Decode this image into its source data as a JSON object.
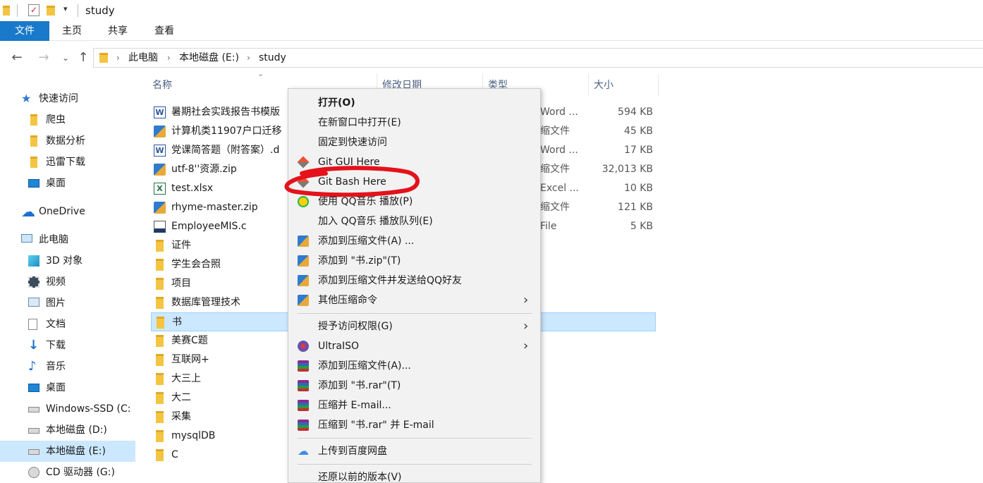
{
  "window": {
    "title": "study"
  },
  "ribbon": {
    "tabs": [
      "文件",
      "主页",
      "共享",
      "查看"
    ]
  },
  "address": {
    "crumbs": [
      "此电脑",
      "本地磁盘 (E:)",
      "study"
    ]
  },
  "sidebar": {
    "items": [
      {
        "label": "快速访问",
        "icon": "star-icon"
      },
      {
        "label": "爬虫",
        "icon": "folder-icon"
      },
      {
        "label": "数据分析",
        "icon": "folder-icon"
      },
      {
        "label": "迅雷下载",
        "icon": "folder-icon"
      },
      {
        "label": "桌面",
        "icon": "desktop-icon"
      },
      {
        "label": "OneDrive",
        "icon": "cloud-icon"
      },
      {
        "label": "此电脑",
        "icon": "computer-icon"
      },
      {
        "label": "3D 对象",
        "icon": "cube-icon"
      },
      {
        "label": "视频",
        "icon": "film-icon"
      },
      {
        "label": "图片",
        "icon": "picture-icon"
      },
      {
        "label": "文档",
        "icon": "document-icon"
      },
      {
        "label": "下载",
        "icon": "download-icon"
      },
      {
        "label": "音乐",
        "icon": "music-icon"
      },
      {
        "label": "桌面",
        "icon": "desktop-icon"
      },
      {
        "label": "Windows-SSD (C:",
        "icon": "drive-icon"
      },
      {
        "label": "本地磁盘 (D:)",
        "icon": "drive-icon"
      },
      {
        "label": "本地磁盘 (E:)",
        "icon": "drive-icon"
      },
      {
        "label": "CD 驱动器 (G:)",
        "icon": "cd-icon"
      }
    ]
  },
  "columns": {
    "name": "名称",
    "date": "修改日期",
    "type": "类型",
    "size": "大小"
  },
  "files": [
    {
      "name": "暑期社会实践报告书模版",
      "type": "Word ...",
      "size": "594 KB",
      "icon": "word-icon"
    },
    {
      "name": "计算机类11907户口迁移",
      "type": "缩文件",
      "size": "45 KB",
      "icon": "zip-icon"
    },
    {
      "name": "党课简答题（附答案）.d",
      "type": "Word ...",
      "size": "17 KB",
      "icon": "word-icon"
    },
    {
      "name": "utf-8''资源.zip",
      "type": "缩文件",
      "size": "32,013 KB",
      "icon": "zip-icon"
    },
    {
      "name": "test.xlsx",
      "type": "Excel ...",
      "size": "10 KB",
      "icon": "excel-icon"
    },
    {
      "name": "rhyme-master.zip",
      "type": "缩文件",
      "size": "121 KB",
      "icon": "zip-icon"
    },
    {
      "name": "EmployeeMIS.c",
      "type": "File",
      "size": "5 KB",
      "icon": "c-file-icon"
    },
    {
      "name": "证件",
      "type": "",
      "size": "",
      "icon": "folder-icon"
    },
    {
      "name": "学生会合照",
      "type": "",
      "size": "",
      "icon": "folder-icon"
    },
    {
      "name": "项目",
      "type": "",
      "size": "",
      "icon": "folder-icon"
    },
    {
      "name": "数据库管理技术",
      "type": "",
      "size": "",
      "icon": "folder-icon"
    },
    {
      "name": "书",
      "type": "",
      "size": "",
      "icon": "folder-icon",
      "selected": true
    },
    {
      "name": "美赛C题",
      "type": "",
      "size": "",
      "icon": "folder-icon"
    },
    {
      "name": "互联网+",
      "type": "",
      "size": "",
      "icon": "folder-icon"
    },
    {
      "name": "大三上",
      "type": "",
      "size": "",
      "icon": "folder-icon"
    },
    {
      "name": "大二",
      "type": "",
      "size": "",
      "icon": "folder-icon"
    },
    {
      "name": "采集",
      "type": "",
      "size": "",
      "icon": "folder-icon"
    },
    {
      "name": "mysqlDB",
      "type": "",
      "size": "",
      "icon": "folder-icon"
    },
    {
      "name": "C",
      "type": "",
      "size": "",
      "icon": "folder-icon"
    }
  ],
  "context_menu": {
    "items": [
      {
        "label": "打开(O)",
        "bold": true
      },
      {
        "label": "在新窗口中打开(E)"
      },
      {
        "label": "固定到快速访问"
      },
      {
        "label": "Git GUI Here",
        "icon": "git-icon"
      },
      {
        "label": "Git Bash Here",
        "icon": "git-icon",
        "highlighted": true
      },
      {
        "label": "使用 QQ音乐 播放(P)",
        "icon": "qq-music-icon"
      },
      {
        "label": "加入 QQ音乐 播放队列(E)"
      },
      {
        "label": "添加到压缩文件(A) ...",
        "icon": "zip-icon"
      },
      {
        "label": "添加到 \"书.zip\"(T)",
        "icon": "zip-icon"
      },
      {
        "label": "添加到压缩文件并发送给QQ好友",
        "icon": "zip-icon"
      },
      {
        "label": "其他压缩命令",
        "icon": "zip-icon",
        "submenu": true
      },
      {
        "label": "授予访问权限(G)",
        "submenu": true,
        "separator_before": true
      },
      {
        "label": "UltraISO",
        "icon": "ultraiso-icon",
        "submenu": true
      },
      {
        "label": "添加到压缩文件(A)...",
        "icon": "rar-icon"
      },
      {
        "label": "添加到 \"书.rar\"(T)",
        "icon": "rar-icon"
      },
      {
        "label": "压缩并 E-mail...",
        "icon": "rar-icon"
      },
      {
        "label": "压缩到 \"书.rar\" 并 E-mail",
        "icon": "rar-icon"
      },
      {
        "label": "上传到百度网盘",
        "icon": "baidu-cloud-icon",
        "separator_before": true
      },
      {
        "label": "还原以前的版本(V)",
        "separator_before": true
      }
    ]
  },
  "colors": {
    "accent": "#1979ca",
    "selection": "#cce8ff",
    "annotation": "#e3121b"
  }
}
